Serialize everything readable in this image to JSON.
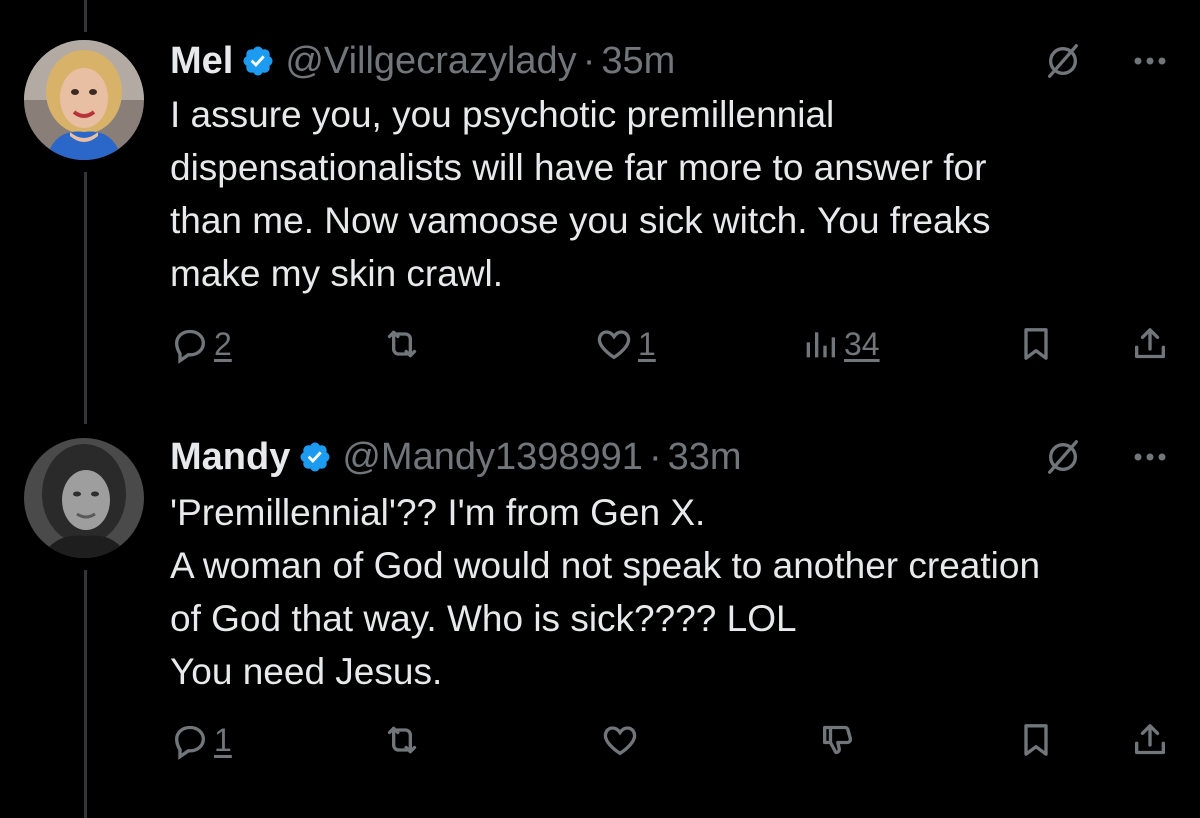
{
  "colors": {
    "background": "#000000",
    "text_primary": "#e7e9ea",
    "text_secondary": "#71767b",
    "verified_blue": "#1d9bf0",
    "thread_line": "#333639"
  },
  "tweets": [
    {
      "display_name": "Mel",
      "verified": true,
      "handle": "@Villgecrazylady",
      "separator": "·",
      "time": "35m",
      "text": "I assure you, you psychotic premillennial\ndispensationalists will have far more to answer for\nthan me. Now vamoose you sick witch. You freaks\nmake my skin crawl.",
      "actions": {
        "reply_count": "2",
        "repost_count": "",
        "like_count": "1",
        "views_count": "34"
      }
    },
    {
      "display_name": "Mandy",
      "verified": true,
      "handle": "@Mandy1398991",
      "separator": "·",
      "time": "33m",
      "text": "'Premillennial'?? I'm from Gen X.\nA woman of God would not speak to another creation\nof God that way. Who is sick???? LOL\nYou need Jesus.",
      "actions": {
        "reply_count": "1",
        "repost_count": "",
        "like_count": ""
      }
    }
  ],
  "icons": {
    "reply": "speech-bubble-icon",
    "repost": "repost-arrows-icon",
    "like": "heart-icon",
    "views": "bar-chart-icon",
    "downvote": "thumbs-down-icon",
    "bookmark": "bookmark-icon",
    "share": "share-upload-icon",
    "grok": "grok-slash-circle-icon",
    "more": "more-dots-icon",
    "verified": "verified-badge-icon"
  }
}
